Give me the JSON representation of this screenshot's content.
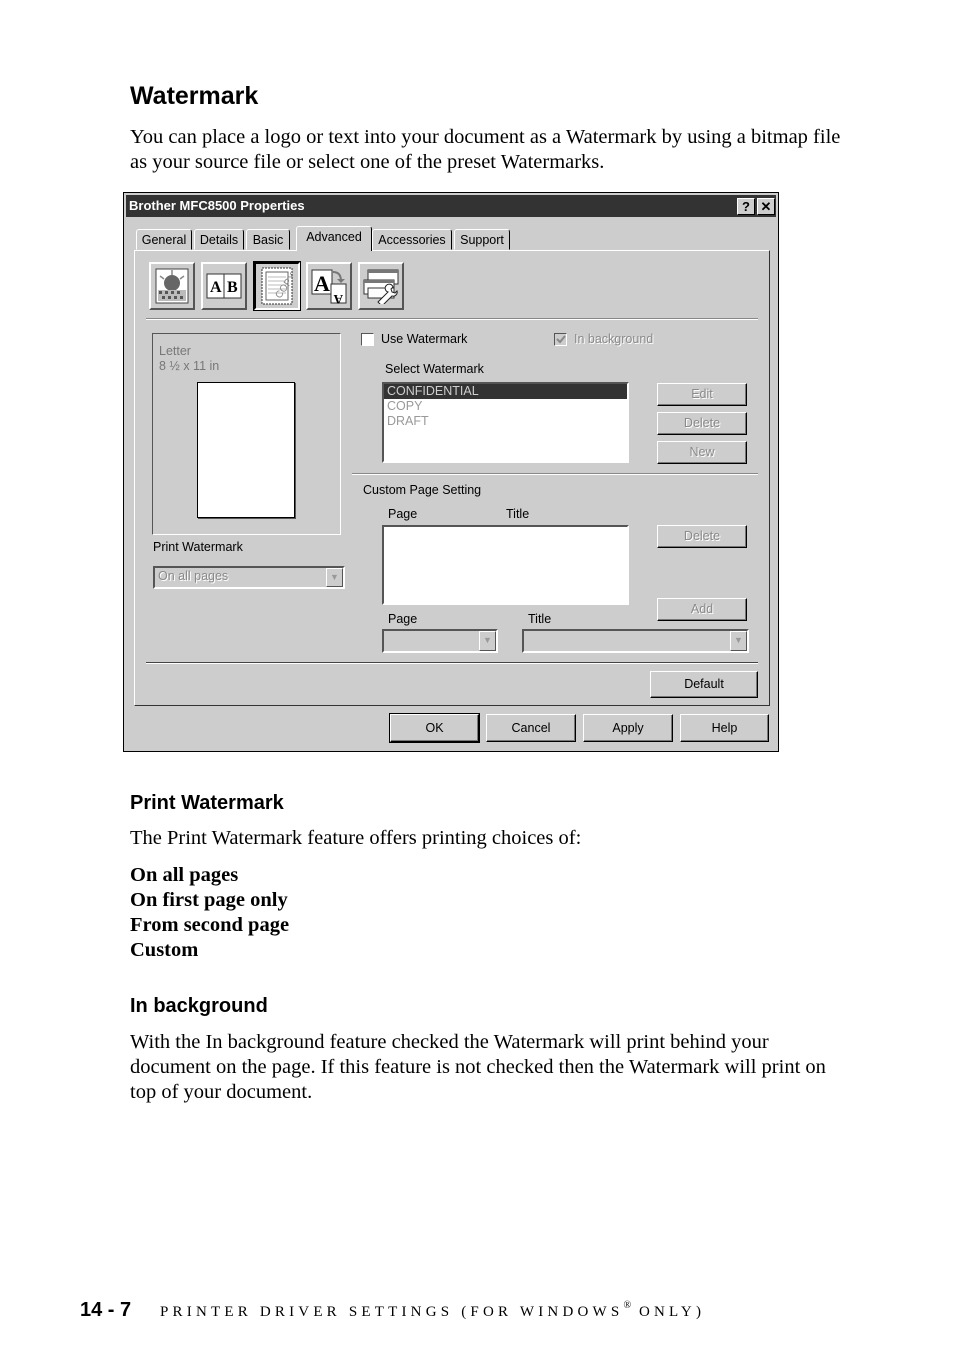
{
  "heading": "Watermark",
  "intro": "You can place a logo or text into your document as a Watermark by using a bitmap file as your source file or select one of the preset Watermarks.",
  "dialog": {
    "title": "Brother MFC8500 Properties",
    "help_button": "?",
    "close_button": "✕",
    "tabs": [
      "General",
      "Details",
      "Basic",
      "Advanced",
      "Accessories",
      "Support"
    ],
    "active_tab": "Advanced",
    "toolbar_icons": [
      "graphics-quality-icon",
      "duplex-icon",
      "watermark-icon",
      "font-substitution-icon",
      "device-options-icon"
    ],
    "paper_name": "Letter",
    "paper_size": "8 ½ x 11 in",
    "use_watermark_label": "Use Watermark",
    "use_watermark_checked": false,
    "in_background_label": "In background",
    "in_background_checked": true,
    "select_watermark_label": "Select Watermark",
    "watermarks": [
      "CONFIDENTIAL",
      "COPY",
      "DRAFT"
    ],
    "selected_watermark": "CONFIDENTIAL",
    "edit_button": "Edit",
    "delete_button": "Delete",
    "new_button": "New",
    "custom_page_setting_label": "Custom Page Setting",
    "custom_col_page": "Page",
    "custom_col_title": "Title",
    "custom_delete_button": "Delete",
    "add_button": "Add",
    "page_label": "Page",
    "title_label": "Title",
    "print_watermark_label": "Print Watermark",
    "print_watermark_value": "On all pages",
    "default_button": "Default",
    "ok_button": "OK",
    "cancel_button": "Cancel",
    "apply_button": "Apply",
    "help_bottom_button": "Help"
  },
  "print_watermark_heading": "Print Watermark",
  "print_watermark_text": "The Print Watermark feature offers printing choices of:",
  "print_choices": [
    "On all pages",
    "On first page only",
    "From second page",
    "Custom"
  ],
  "in_background_heading": "In background",
  "in_background_text": "With the In background feature checked the Watermark will print behind your document on the page. If this feature is not checked then the Watermark will print on top of your document.",
  "footer": {
    "page_number": "14 - 7",
    "section_title": "PRINTER DRIVER SETTINGS (FOR WINDOWS",
    "registered": "®",
    "section_suffix": " ONLY)"
  }
}
